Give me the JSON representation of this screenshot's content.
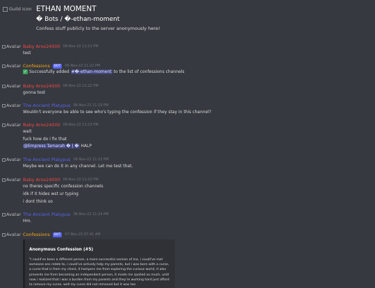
{
  "header": {
    "guild_icon_alt": "Guild icon",
    "guild_name": "ETHAN MOMENT",
    "channel_path": "� Bots / �-ethan-moment",
    "channel_description": "Confess stuff publicly to the server anonymously here!"
  },
  "avatar_alt": "Avatar",
  "bot_tag": "BOT",
  "colors": {
    "baby_arox": "#f04747",
    "confessions": "#faa61a",
    "ancient_platypus": "#5865f2",
    "success_check": "#3ba55c",
    "mention_bg": "#5865f2"
  },
  "messages": [
    {
      "author": "Baby Arox24000",
      "timestamp": "06-Nov-22 11:21 PM",
      "lines": [
        "test"
      ]
    },
    {
      "author": "Confessions",
      "bot": true,
      "timestamp": "06-Nov-22 11:22 PM",
      "line_prefix": "Successfully added ",
      "line_mention": "#�-ethan-moment",
      "line_suffix": " to the list of confessions channels"
    },
    {
      "author": "Baby Arox24000",
      "timestamp": "06-Nov-22 11:22 PM",
      "lines": [
        "gonna test"
      ]
    },
    {
      "author": "The Ancient Platypus",
      "timestamp": "06-Nov-22 11:23 PM",
      "lines": [
        "Wouldn't everyone be able to see who's typing the confession if they stay in this channel?"
      ]
    },
    {
      "author": "Baby Arox24000",
      "timestamp": "06-Nov-22 11:23 PM",
      "lines": [
        "wait",
        "fuck how do i fix that"
      ],
      "mention": "@Empress Tamarah � | �",
      "mention_suffix": " HALP"
    },
    {
      "author": "The Ancient Platypus",
      "timestamp": "06-Nov-22 11:23 PM",
      "lines": [
        "Maybe we can do it in any channel. Let me test that."
      ]
    },
    {
      "author": "Baby Arox24000",
      "timestamp": "06-Nov-22 11:23 PM",
      "lines": [
        "no theres specific confession channels",
        "idk if it hides wst ur typing",
        "i dont think so"
      ]
    },
    {
      "author": "The Ancient Platypus",
      "timestamp": "06-Nov-22 11:24 PM",
      "lines": [
        "Hm."
      ]
    },
    {
      "author": "Confessions",
      "bot": true,
      "timestamp": "07-Nov-22 07:41 AM",
      "embed": {
        "title": "Anonymous Confession (#5)",
        "description": "\"I could've been a different person, a more successful version of me, i could've met someone ans relate to, i could've actively help my parents, but i was born with a curse, a curse that is from my chest, it hampers me from exploring the curious world, it also prevents me from becoming an independent person, it made me spoiled so much, until now i realized that i was a burden from my parents and they're working hard just afford to remove my curse, well my curse did not removed but it was too"
      }
    }
  ]
}
